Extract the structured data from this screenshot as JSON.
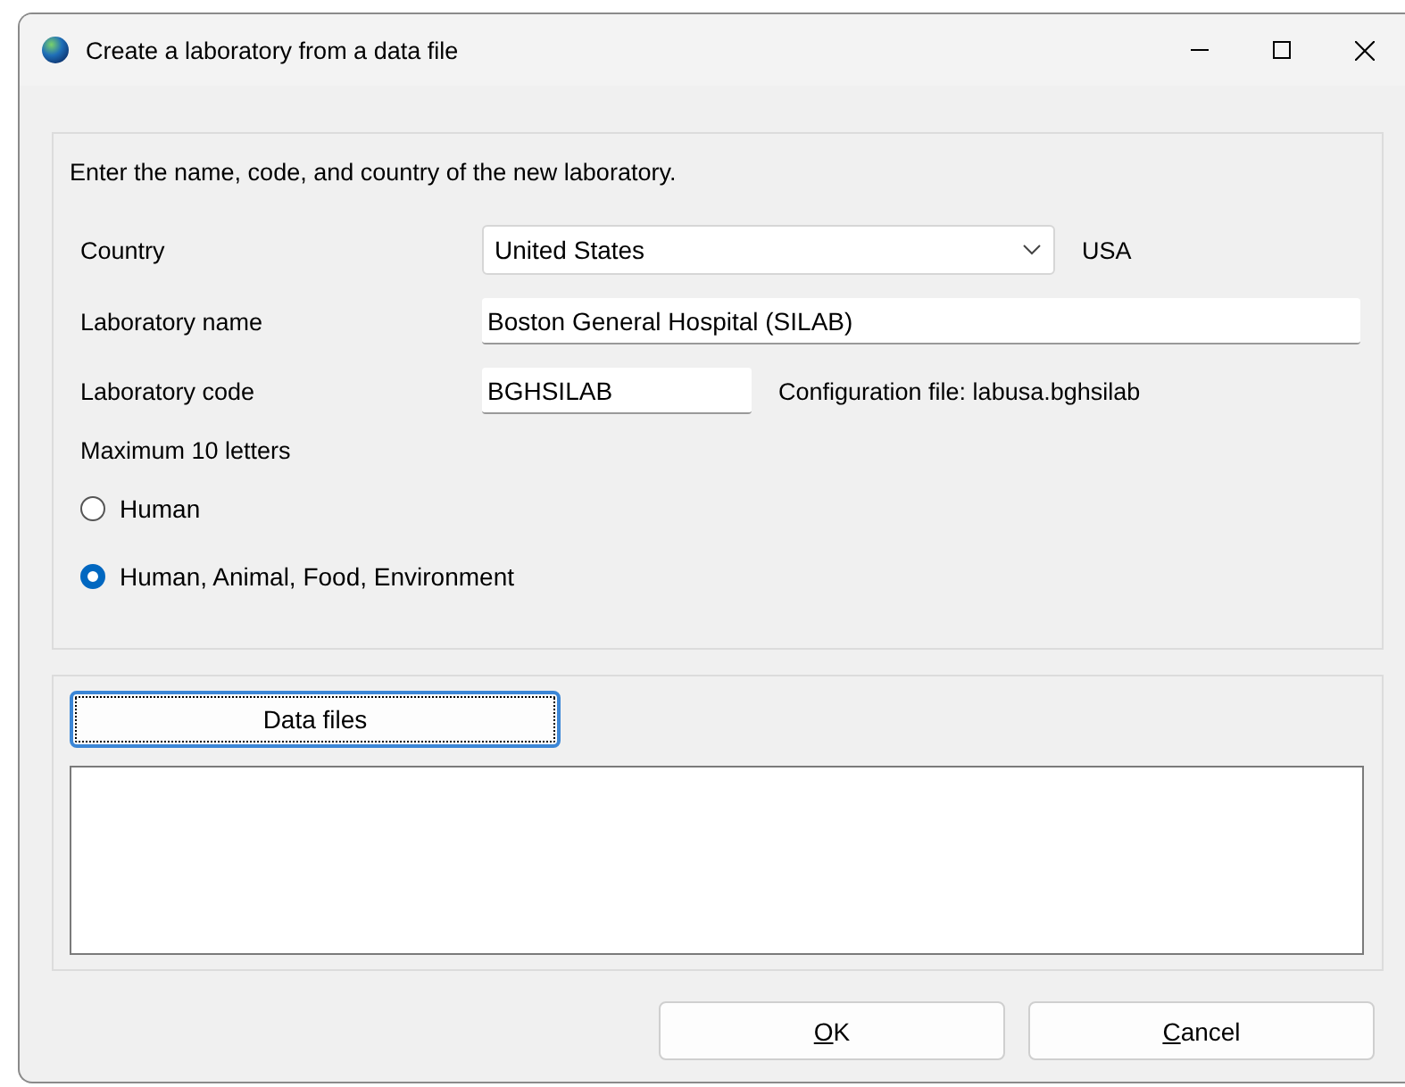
{
  "window": {
    "title": "Create a laboratory from a data file"
  },
  "instruction": "Enter the name, code, and country of the new laboratory.",
  "country": {
    "label": "Country",
    "value": "United States",
    "code": "USA"
  },
  "lab_name": {
    "label": "Laboratory name",
    "value": "Boston General Hospital (SILAB)"
  },
  "lab_code": {
    "label": "Laboratory code",
    "value": "BGHSILAB",
    "config": "Configuration file: labusa.bghsilab",
    "hint": "Maximum 10 letters"
  },
  "scope": [
    {
      "label": "Human",
      "selected": false
    },
    {
      "label": "Human, Animal, Food, Environment",
      "selected": true
    }
  ],
  "data_files_button": {
    "label": "Data files",
    "focused": true
  },
  "buttons": [
    {
      "label": "OK",
      "first_letter_underlined": true
    },
    {
      "label": "Cancel",
      "first_letter_underlined": true
    }
  ]
}
